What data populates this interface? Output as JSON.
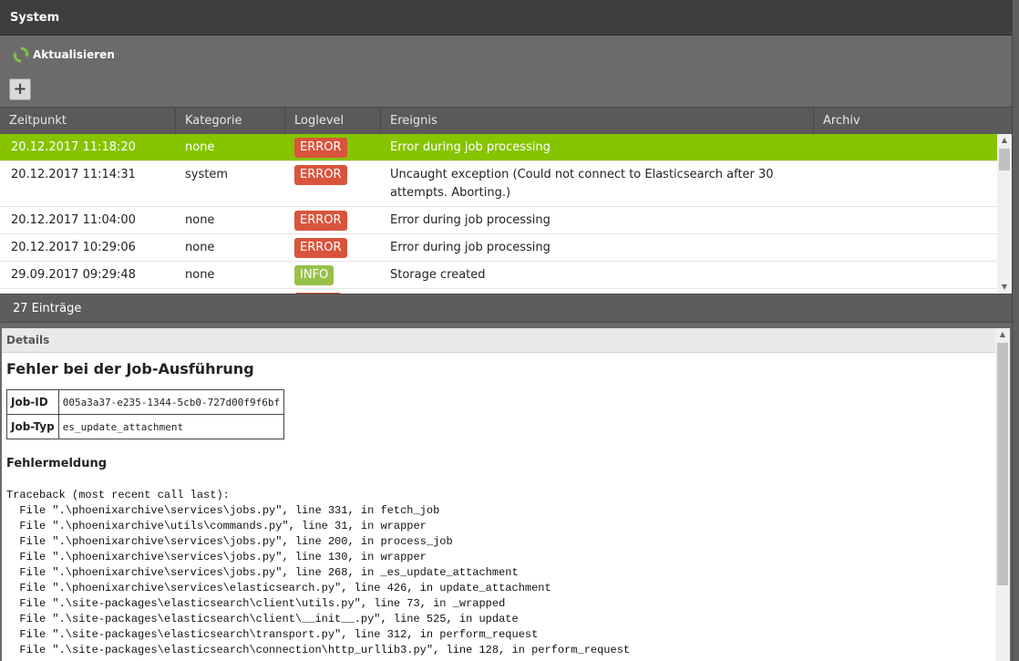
{
  "panel": {
    "title": "System"
  },
  "toolbar": {
    "refresh_label": "Aktualisieren",
    "add_label": "+"
  },
  "table": {
    "columns": [
      "Zeitpunkt",
      "Kategorie",
      "Loglevel",
      "Ereignis",
      "Archiv"
    ],
    "rows": [
      {
        "time": "20.12.2017 11:18:20",
        "category": "none",
        "level": "ERROR",
        "event": "Error during job processing",
        "archive": ""
      },
      {
        "time": "20.12.2017 11:14:31",
        "category": "system",
        "level": "ERROR",
        "event": "Uncaught exception (Could not connect to Elasticsearch after 30 attempts. Aborting.)",
        "archive": ""
      },
      {
        "time": "20.12.2017 11:04:00",
        "category": "none",
        "level": "ERROR",
        "event": "Error during job processing",
        "archive": ""
      },
      {
        "time": "20.12.2017 10:29:06",
        "category": "none",
        "level": "ERROR",
        "event": "Error during job processing",
        "archive": ""
      },
      {
        "time": "29.09.2017 09:29:48",
        "category": "none",
        "level": "INFO",
        "event": "Storage created",
        "archive": ""
      }
    ],
    "footer": "27 Einträge"
  },
  "details": {
    "header": "Details",
    "title": "Fehler bei der Job-Ausführung",
    "job_id_label": "Job-ID",
    "job_id": "005a3a37-e235-1344-5cb0-727d00f9f6bf",
    "job_type_label": "Job-Typ",
    "job_type": "es_update_attachment",
    "error_label": "Fehlermeldung",
    "traceback": "Traceback (most recent call last):\n  File \".\\phoenixarchive\\services\\jobs.py\", line 331, in fetch_job\n  File \".\\phoenixarchive\\utils\\commands.py\", line 31, in wrapper\n  File \".\\phoenixarchive\\services\\jobs.py\", line 200, in process_job\n  File \".\\phoenixarchive\\services\\jobs.py\", line 130, in wrapper\n  File \".\\phoenixarchive\\services\\jobs.py\", line 268, in _es_update_attachment\n  File \".\\phoenixarchive\\services\\elasticsearch.py\", line 426, in update_attachment\n  File \".\\site-packages\\elasticsearch\\client\\utils.py\", line 73, in _wrapped\n  File \".\\site-packages\\elasticsearch\\client\\__init__.py\", line 525, in update\n  File \".\\site-packages\\elasticsearch\\transport.py\", line 312, in perform_request\n  File \".\\site-packages\\elasticsearch\\connection\\http_urllib3.py\", line 128, in perform_request"
  },
  "colors": {
    "selected_row": "#86c400",
    "error_badge": "#d9543d",
    "info_badge": "#98c14a",
    "refresh_icon": "#7dc242"
  },
  "icons": {
    "refresh": "refresh-icon",
    "add": "plus-icon"
  }
}
